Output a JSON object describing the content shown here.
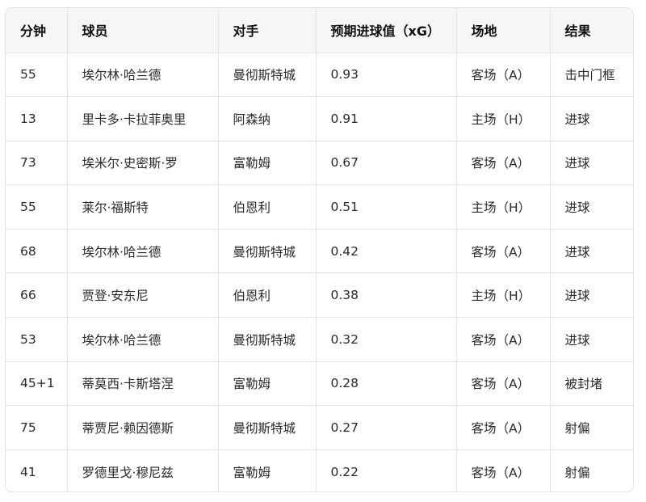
{
  "table": {
    "headers": [
      "分钟",
      "球员",
      "对手",
      "预期进球值（xG）",
      "场地",
      "结果"
    ],
    "rows": [
      [
        "55",
        "埃尔林·哈兰德",
        "曼彻斯特城",
        "0.93",
        "客场（A）",
        "击中门框"
      ],
      [
        "13",
        "里卡多·卡拉菲奥里",
        "阿森纳",
        "0.91",
        "主场（H）",
        "进球"
      ],
      [
        "73",
        "埃米尔·史密斯·罗",
        "富勒姆",
        "0.67",
        "客场（A）",
        "进球"
      ],
      [
        "55",
        "莱尔·福斯特",
        "伯恩利",
        "0.51",
        "主场（H）",
        "进球"
      ],
      [
        "68",
        "埃尔林·哈兰德",
        "曼彻斯特城",
        "0.42",
        "客场（A）",
        "进球"
      ],
      [
        "66",
        "贾登·安东尼",
        "伯恩利",
        "0.38",
        "主场（H）",
        "进球"
      ],
      [
        "53",
        "埃尔林·哈兰德",
        "曼彻斯特城",
        "0.32",
        "客场（A）",
        "进球"
      ],
      [
        "45+1",
        "蒂莫西·卡斯塔涅",
        "富勒姆",
        "0.28",
        "客场（A）",
        "被封堵"
      ],
      [
        "75",
        "蒂贾尼·赖因德斯",
        "曼彻斯特城",
        "0.27",
        "客场（A）",
        "射偏"
      ],
      [
        "41",
        "罗德里戈·穆尼兹",
        "富勒姆",
        "0.22",
        "客场（A）",
        "射偏"
      ]
    ]
  }
}
